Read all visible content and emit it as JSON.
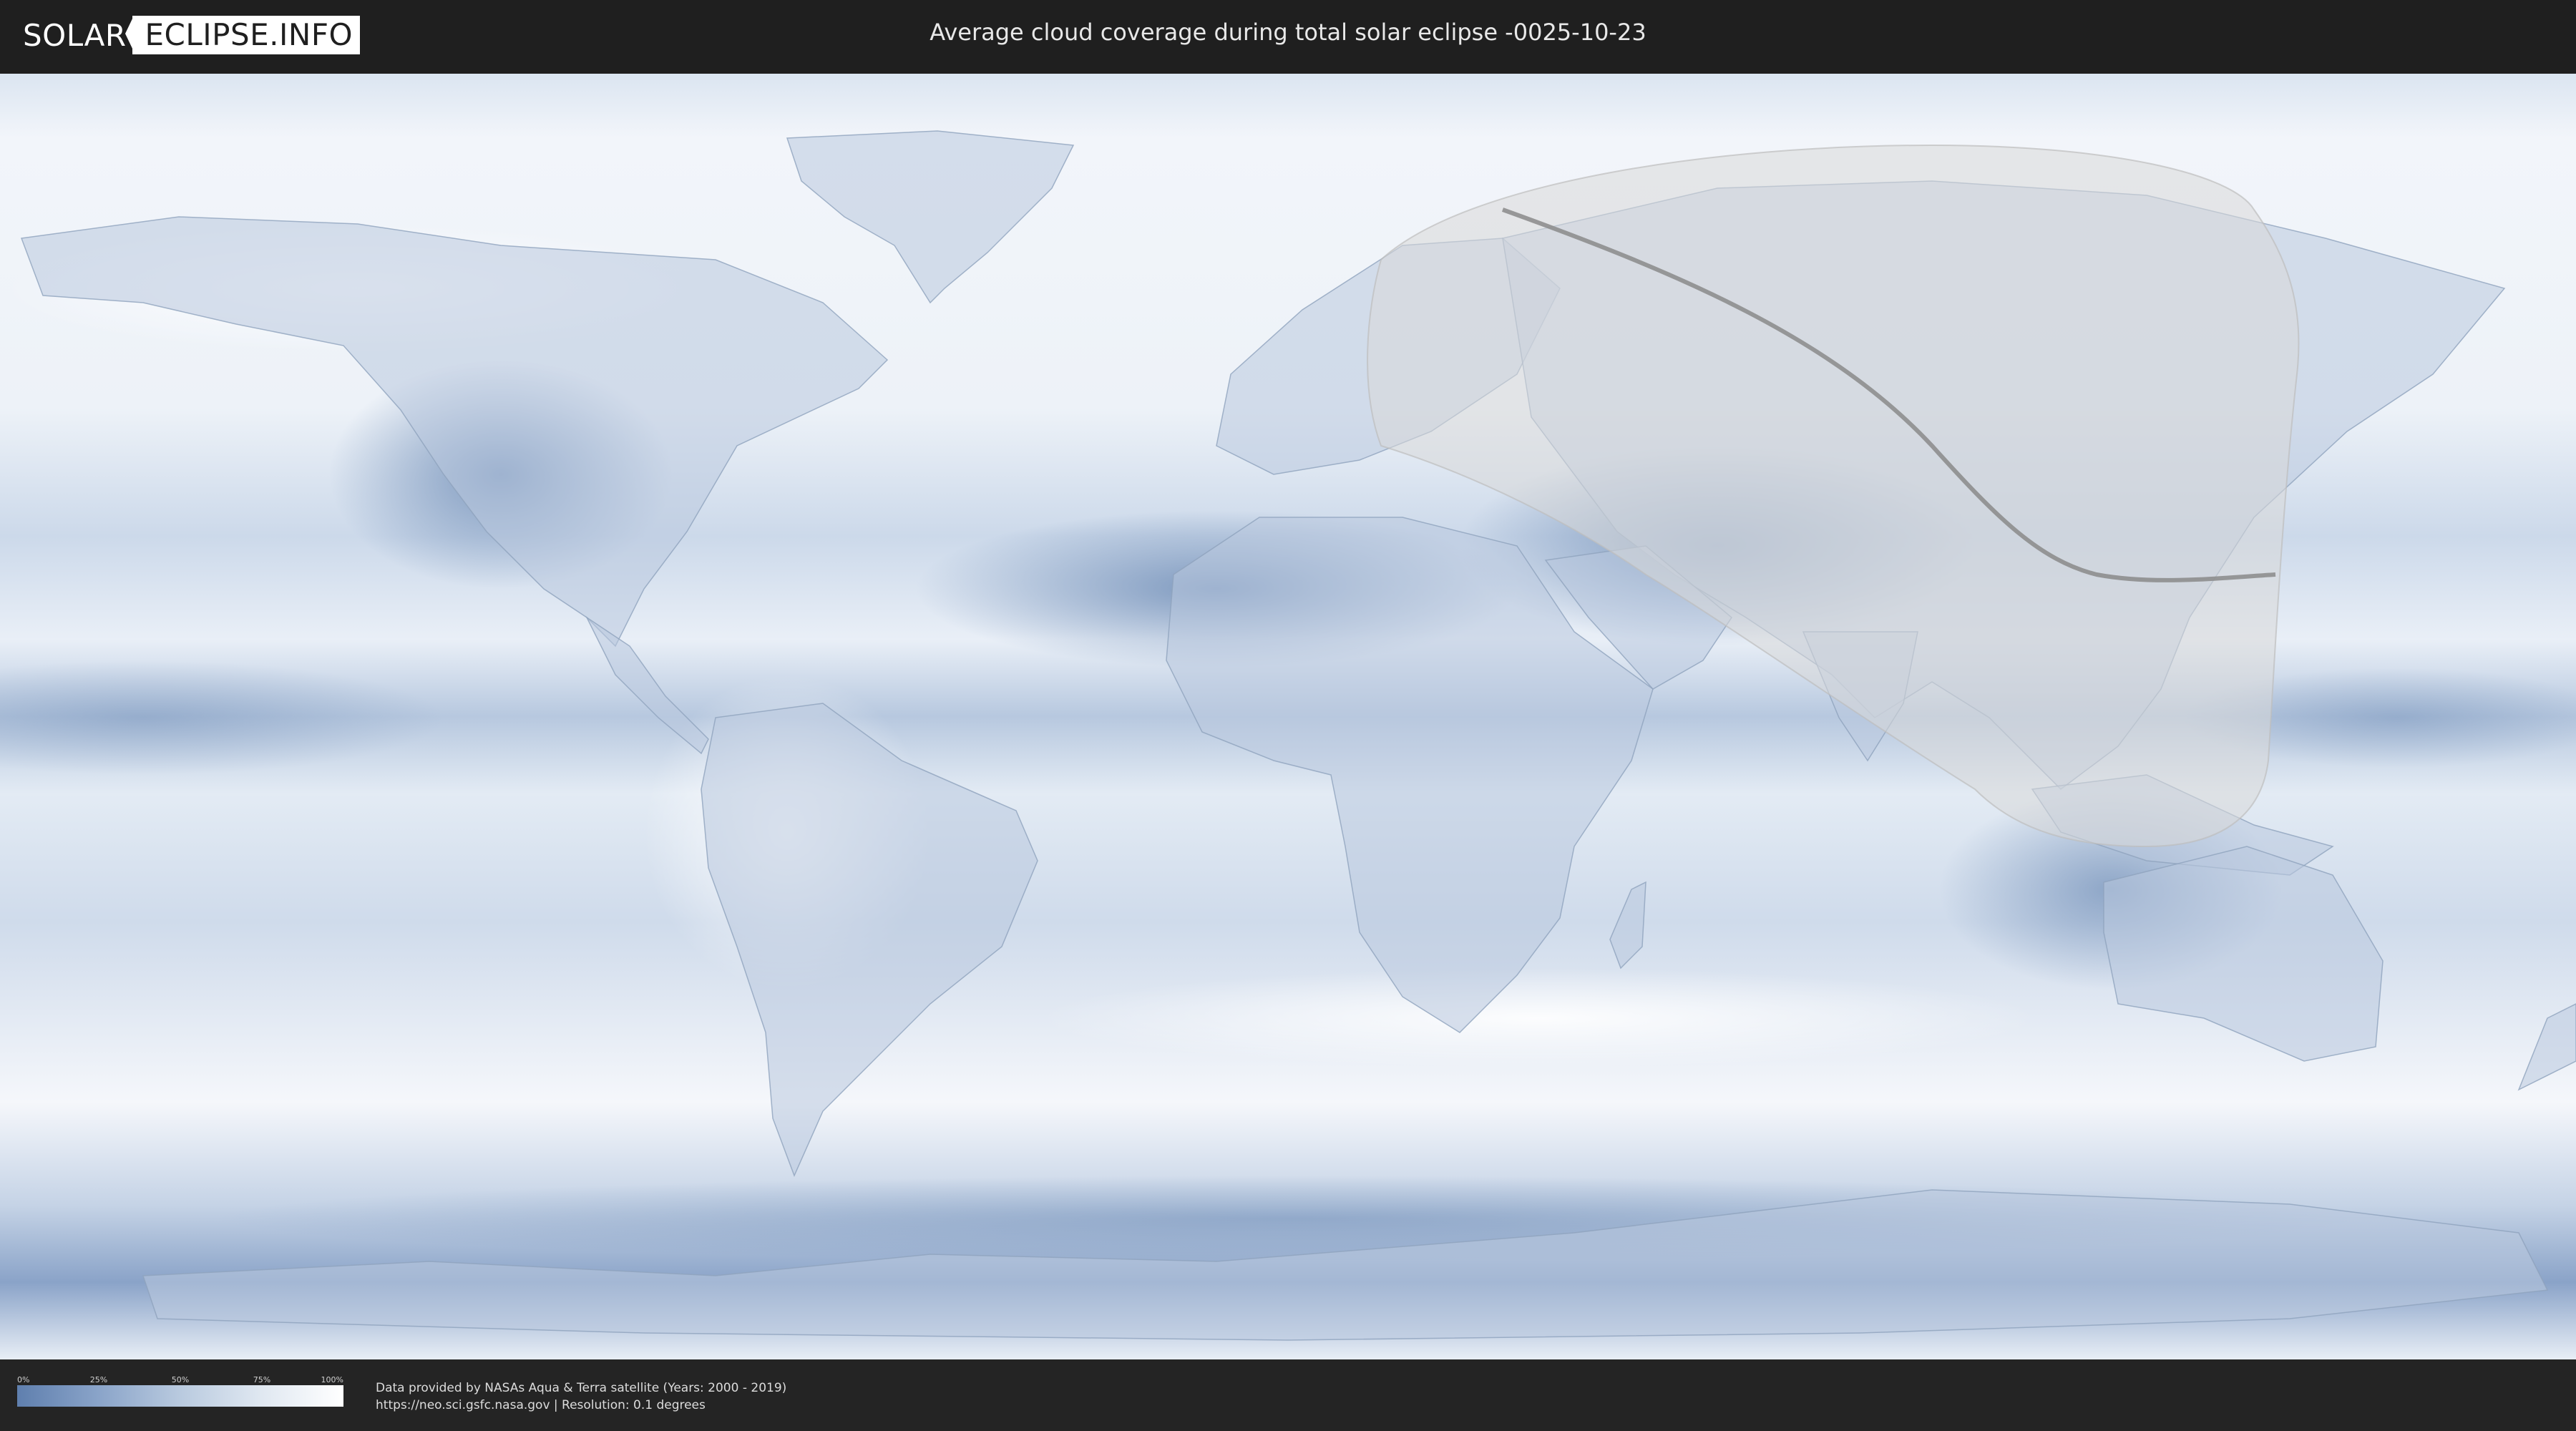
{
  "header": {
    "logo_left": "SOLAR",
    "logo_right": "ECLIPSE.INFO",
    "title": "Average cloud coverage during total solar eclipse -0025-10-23"
  },
  "legend": {
    "ticks": [
      "0%",
      "25%",
      "50%",
      "75%",
      "100%"
    ],
    "colors": {
      "low": "#5f7fae",
      "mid": "#b9cadf",
      "high": "#ffffff"
    }
  },
  "credits": {
    "line1": "Data provided by NASAs Aqua & Terra satellite (Years: 2000 - 2019)",
    "line2": "https://neo.sci.gsfc.nasa.gov | Resolution: 0.1 degrees"
  },
  "map": {
    "colors": {
      "ocean_clear": "#6b8cbc",
      "cloud_white": "#f3f6fb",
      "eclipse_zone": "#d9d9d9",
      "eclipse_path": "#8a8a8a"
    }
  }
}
